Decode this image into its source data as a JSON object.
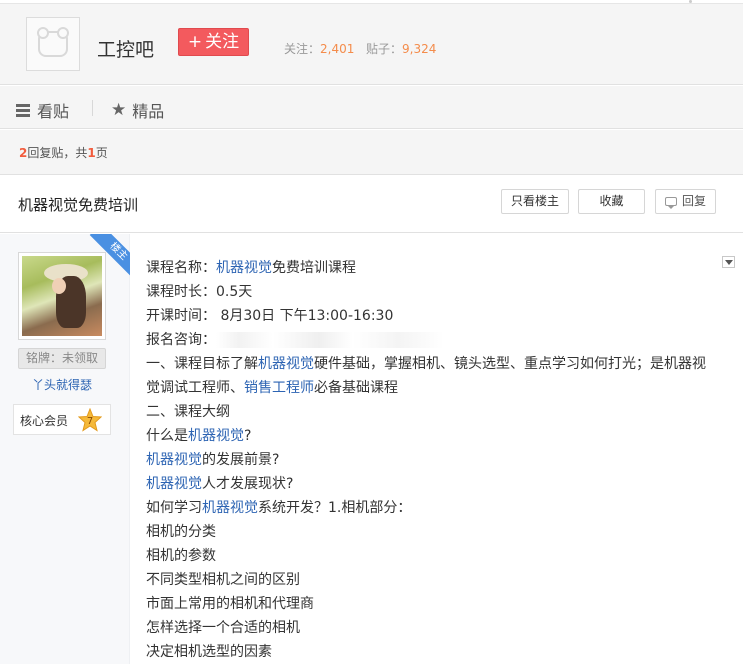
{
  "forum": {
    "name": "工控吧",
    "follow_label": "关注",
    "follow_plus": "+",
    "followers_label": "关注：",
    "followers_count": "2,401",
    "posts_label": "贴子：",
    "posts_count": "9,324"
  },
  "nav": {
    "tabs": [
      {
        "label": "看贴",
        "icon": "document-list-icon"
      },
      {
        "label": "精品",
        "icon": "star-icon"
      }
    ]
  },
  "reply_info": {
    "reply_count": "2",
    "reply_label": "回复贴，共",
    "page_count": "1",
    "page_label": "页"
  },
  "thread": {
    "title": "机器视觉免费培训",
    "buttons": {
      "only_op": "只看楼主",
      "favorite": "收藏",
      "reply": "回复"
    }
  },
  "post": {
    "badge": "楼主",
    "author": {
      "medal_label": "铭牌：未领取",
      "username": "丫头就得瑟",
      "member_label": "核心会员",
      "level": "7"
    },
    "content": {
      "l1_a": "课程名称：",
      "l1_kw": "机器视觉",
      "l1_b": "免费培训课程",
      "l2": "课程时长：0.5天",
      "l3": "开课时间：  8月30日 下午13:00-16:30",
      "l4_a": "报名咨询：",
      "l5_a": "一、课程目标了解",
      "l5_kw": "机器视觉",
      "l5_b": "硬件基础，掌握相机、镜头选型、重点学习如何打光；是机器视觉调试工程师、",
      "l5_kw2": "销售工程师",
      "l5_c": "必备基础课程",
      "l6": "二、课程大纲",
      "l7_a": "什么是",
      "l7_kw": "机器视觉",
      "l7_b": "?",
      "l8_kw": "机器视觉",
      "l8_b": "的发展前景?",
      "l9_kw": "机器视觉",
      "l9_b": "人才发展现状?",
      "l10_a": "如何学习",
      "l10_kw": "机器视觉",
      "l10_b": "系统开发？1.相机部分：",
      "l11": "相机的分类",
      "l12": "相机的参数",
      "l13": "不同类型相机之间的区别",
      "l14": "市面上常用的相机和代理商",
      "l15": "怎样选择一个合适的相机",
      "l16": "决定相机选型的因素"
    }
  },
  "colors": {
    "accent_red": "#f35a5e",
    "link_blue": "#2d64b3",
    "stat_orange": "#f48c4b"
  }
}
